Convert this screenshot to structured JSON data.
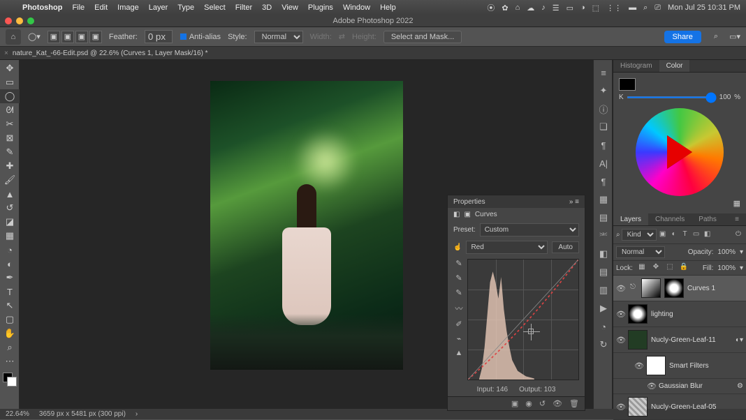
{
  "menubar": {
    "app": "Photoshop",
    "items": [
      "File",
      "Edit",
      "Image",
      "Layer",
      "Type",
      "Select",
      "Filter",
      "3D",
      "View",
      "Plugins",
      "Window",
      "Help"
    ],
    "clock": "Mon Jul 25  10:31 PM"
  },
  "titlebar": "Adobe Photoshop 2022",
  "options": {
    "feather_label": "Feather:",
    "feather_value": "0 px",
    "antialias": "Anti-alias",
    "style_label": "Style:",
    "style_value": "Normal",
    "width_label": "Width:",
    "height_label": "Height:",
    "select_mask": "Select and Mask...",
    "share": "Share"
  },
  "doc_tab": "nature_Kat_-66-Edit.psd @ 22.6% (Curves 1, Layer Mask/16) *",
  "color_panel": {
    "tabs": [
      "Histogram",
      "Color"
    ],
    "active": 1,
    "K_label": "K",
    "K_value": "100",
    "pct": "%"
  },
  "layers_panel": {
    "tabs": [
      "Layers",
      "Channels",
      "Paths"
    ],
    "active": 0,
    "kind": "Kind",
    "blend": "Normal",
    "opacity_label": "Opacity:",
    "opacity": "100%",
    "lock_label": "Lock:",
    "fill_label": "Fill:",
    "fill": "100%",
    "items": [
      {
        "name": "Curves 1",
        "sel": true,
        "thumb": "curve",
        "mask": true
      },
      {
        "name": "lighting",
        "thumb": "mask"
      },
      {
        "name": "Nucly-Green-Leaf-11",
        "thumb": "leaf",
        "smart": true
      },
      {
        "name": "Smart Filters",
        "thumb": "white",
        "nested": true
      },
      {
        "name": "Gaussian Blur",
        "nested2": true
      },
      {
        "name": "Nucly-Green-Leaf-05",
        "thumb": "grid"
      }
    ]
  },
  "properties": {
    "title": "Properties",
    "adj_name": "Curves",
    "preset_label": "Preset:",
    "preset_value": "Custom",
    "channel_value": "Red",
    "auto": "Auto",
    "input_label": "Input:",
    "input_value": "146",
    "output_label": "Output:",
    "output_value": "103"
  },
  "status": {
    "zoom": "22.64%",
    "dim": "3659 px x 5481 px (300 ppi)"
  }
}
